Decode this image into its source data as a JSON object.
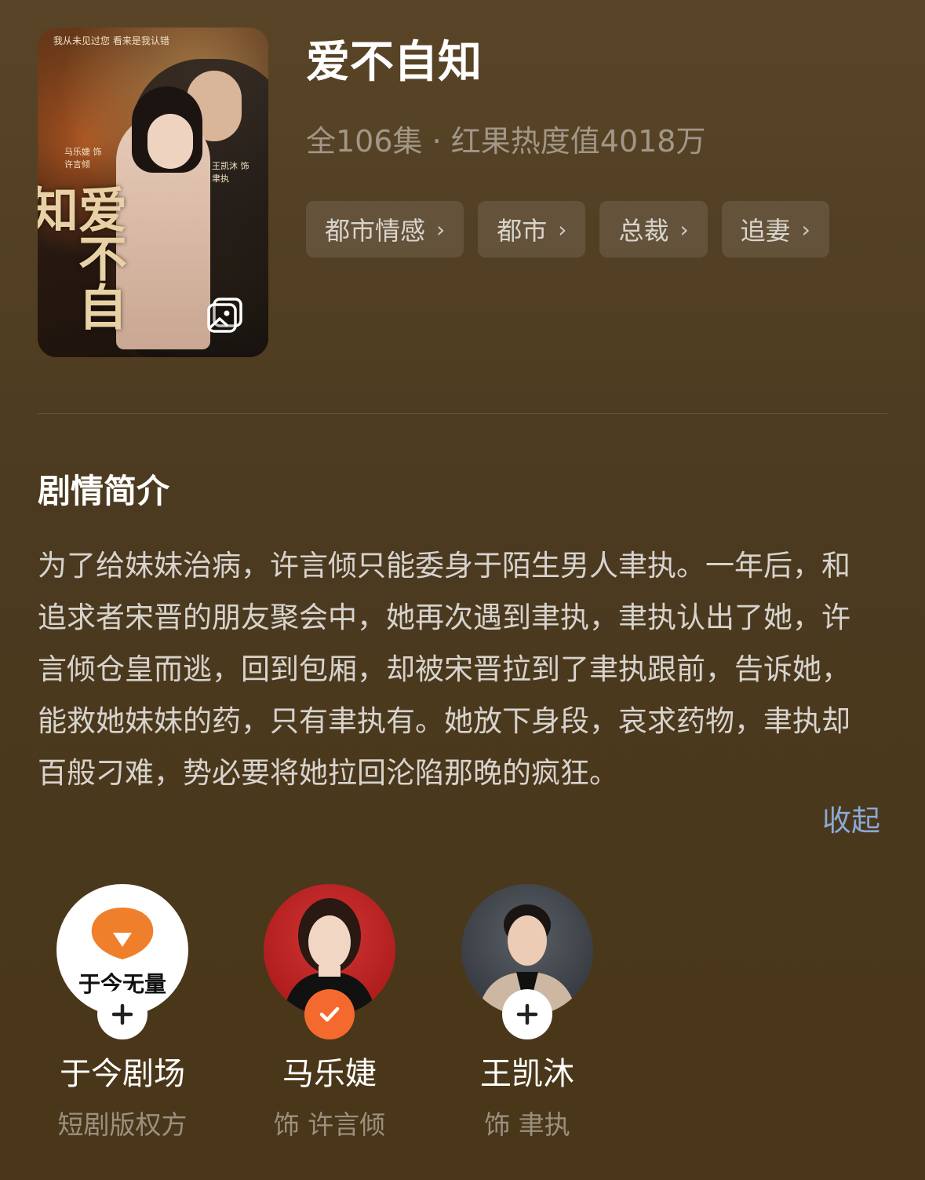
{
  "drama": {
    "title": "爱不自知",
    "meta": "全106集 · 红果热度值4018万",
    "tags": [
      {
        "label": "都市情感"
      },
      {
        "label": "都市"
      },
      {
        "label": "总裁"
      },
      {
        "label": "追妻"
      }
    ]
  },
  "poster": {
    "calligraphy": "爱不自知",
    "tagline": "我从未见过您 看来是我认错",
    "credit_left": "马乐婕 饰 许言倾",
    "credit_right": "王凯沐 饰 聿执",
    "gallery_icon": "gallery-icon"
  },
  "synopsis": {
    "heading": "剧情简介",
    "text": "为了给妹妹治病，许言倾只能委身于陌生男人聿执。一年后，和追求者宋晋的朋友聚会中，她再次遇到聿执，聿执认出了她，许言倾仓皇而逃，回到包厢，却被宋晋拉到了聿执跟前，告诉她，能救她妹妹的药，只有聿执有。她放下身段，哀求药物，聿执却百般刁难，势必要将她拉回沦陷那晚的疯狂。",
    "collapse_label": "收起"
  },
  "cast": [
    {
      "name": "于今剧场",
      "role": "短剧版权方",
      "badge": "plus",
      "logo_text": "于今无量"
    },
    {
      "name": "马乐婕",
      "role": "饰 许言倾",
      "badge": "check"
    },
    {
      "name": "王凯沐",
      "role": "饰 聿执",
      "badge": "plus"
    }
  ],
  "colors": {
    "background": "#4b3a20",
    "link": "#8aaad8",
    "follow_check": "#f46a2e",
    "brand_orange": "#f07f2c"
  }
}
